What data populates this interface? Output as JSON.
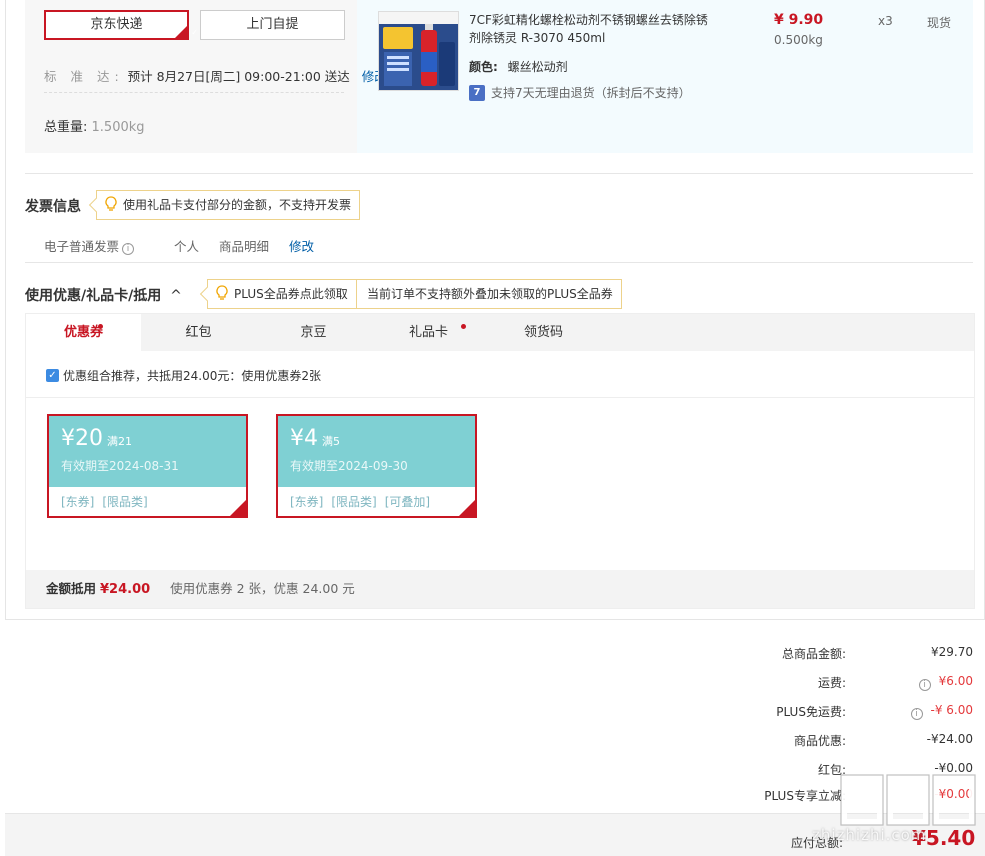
{
  "shipping": {
    "options": [
      "京东快递",
      "上门自提"
    ],
    "standard_label": "标 准 达:",
    "standard_time": "预计 8月27日[周二] 09:00-21:00 送达",
    "modify": "修改",
    "total_weight_label": "总重量:",
    "total_weight_value": "1.500kg"
  },
  "product": {
    "name": "7CF彩虹精化螺栓松动剂不锈钢螺丝去锈除锈剂除锈灵 R-3070 450ml",
    "color_label": "颜色:",
    "color_value": "螺丝松动剂",
    "return_badge": "7",
    "return_policy": "支持7天无理由退货（拆封后不支持）",
    "price": "¥ 9.90",
    "weight": "0.500kg",
    "quantity": "x3",
    "stock": "现货",
    "image_caption": "螺栓松动剂"
  },
  "invoice": {
    "title": "发票信息",
    "tip": "使用礼品卡支付部分的金额，不支持开发票",
    "type": "电子普通发票",
    "info_icon": "i",
    "holder": "个人",
    "content": "商品明细",
    "modify": "修改"
  },
  "discount": {
    "title": "使用优惠/礼品卡/抵用",
    "collapse_icon": "^",
    "plus_tip": "PLUS全品券点此领取",
    "plus_notice": "当前订单不支持额外叠加未领取的PLUS全品券",
    "tabs": [
      "优惠券",
      "红包",
      "京豆",
      "礼品卡",
      "领货码"
    ],
    "combo_text": "优惠组合推荐，共抵用24.00元：使用优惠券2张",
    "coupons": [
      {
        "amount": "¥20",
        "condition": "满21",
        "expiry": "有效期至2024-08-31",
        "tags": [
          "[东券]",
          "[限品类]"
        ]
      },
      {
        "amount": "¥4",
        "condition": "满5",
        "expiry": "有效期至2024-09-30",
        "tags": [
          "[东券]",
          "[限品类]",
          "[可叠加]"
        ]
      }
    ],
    "deduct_label": "金额抵用",
    "deduct_amount": "¥24.00",
    "deduct_note": "使用优惠券 2 张，优惠 24.00 元"
  },
  "summary": {
    "rows": [
      {
        "label": "总商品金额:",
        "value": "¥29.70"
      },
      {
        "label": "运费:",
        "value": "¥6.00"
      },
      {
        "label": "PLUS免运费:",
        "value": "-¥ 6.00"
      },
      {
        "label": "商品优惠:",
        "value": "-¥24.00"
      },
      {
        "label": "红包:",
        "value": "-¥0.00"
      },
      {
        "label": "PLUS专享立减:",
        "value": "-¥0.00"
      }
    ],
    "pay_label": "应付总额:",
    "pay_amount": "¥5.40"
  },
  "watermark": "zhizhizhi.com",
  "colors": {
    "accent": "#c81623",
    "coupon": "#7fd0d3",
    "link": "#005ea7"
  }
}
